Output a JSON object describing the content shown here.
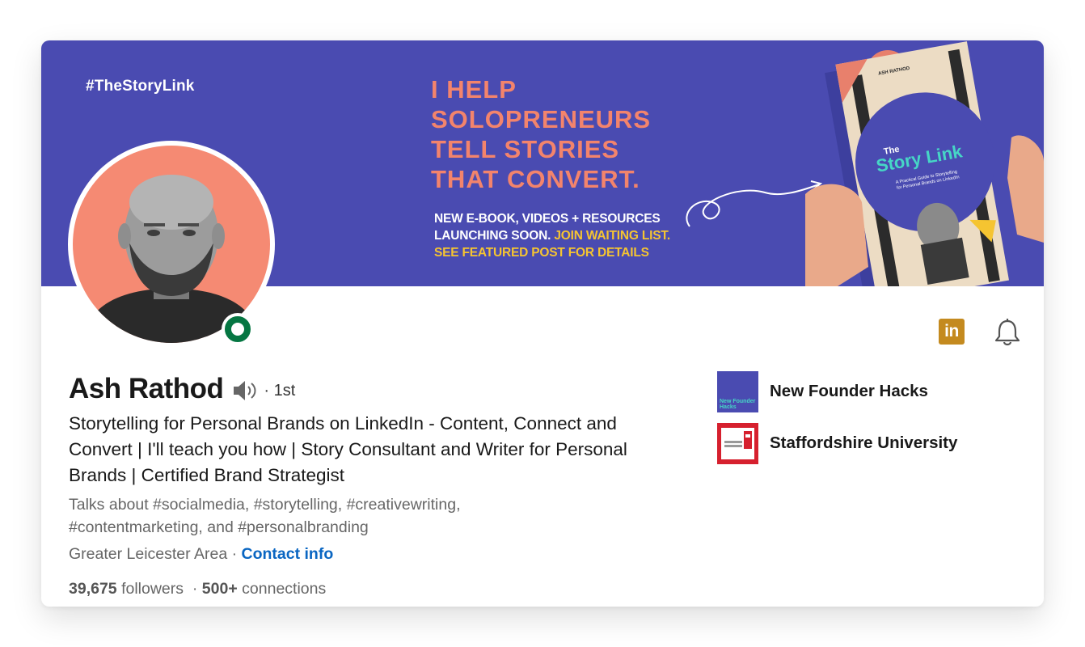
{
  "banner": {
    "hashtag": "#TheStoryLink",
    "headline_lines": [
      "I HELP",
      "SOLOPRENEURS",
      "TELL STORIES",
      "THAT CONVERT."
    ],
    "sub_line1": "NEW E-BOOK, VIDEOS + RESOURCES",
    "sub_line2_white": "LAUNCHING SOON.",
    "sub_line2_yellow": "JOIN WAITING LIST.",
    "sub_line3": "SEE FEATURED POST FOR DETAILS",
    "book_title_the": "The",
    "book_title": "Story Link",
    "book_subtitle_1": "A Practical Guide to Storytelling",
    "book_subtitle_2": "for Personal Brands on LinkedIn",
    "book_author": "ASH RATHOD"
  },
  "profile": {
    "name": "Ash Rathod",
    "degree": "· 1st",
    "headline": "Storytelling for Personal Brands on LinkedIn - Content, Connect and Convert | I'll teach you how | Story Consultant and Writer for Personal Brands | Certified Brand Strategist",
    "talks_about": "Talks about #socialmedia, #storytelling, #creativewriting, #contentmarketing, and #personalbranding",
    "location": "Greater Leicester Area ·",
    "contact_label": "Contact info",
    "followers_count": "39,675",
    "followers_label": "followers",
    "separator": "·",
    "connections_count": "500+",
    "connections_label": "connections"
  },
  "icons": {
    "linkedin_badge": "in",
    "linkedin_color": "#c48a1f",
    "bell": "bell-icon",
    "speaker": "speaker-icon"
  },
  "orgs": [
    {
      "name": "New Founder Hacks",
      "logo_text": "New Founder Hacks"
    },
    {
      "name": "Staffordshire University"
    }
  ],
  "colors": {
    "banner_bg": "#4a4bb1",
    "headline_coral": "#f3846c",
    "accent_yellow": "#f5c431",
    "link_blue": "#0a66c2",
    "online_green": "#057642"
  }
}
